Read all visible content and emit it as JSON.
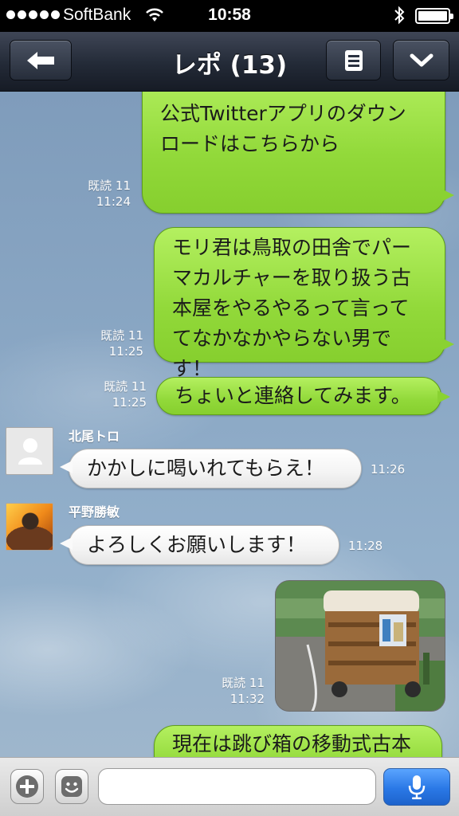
{
  "status_bar": {
    "carrier": "SoftBank",
    "time": "10:58"
  },
  "nav": {
    "title": "レポ (13)",
    "back_icon": "back-arrow-icon",
    "menu_icon": "list-icon",
    "more_icon": "chevron-down-icon"
  },
  "messages": [
    {
      "side": "right",
      "lines": [
        "公式Twitterアプリのダウン",
        "ロードはこちらから"
      ],
      "read": "既読 11",
      "time": "11:24"
    },
    {
      "side": "right",
      "lines": [
        "モリ君は鳥取の田舎でパー",
        "マカルチャーを取り扱う古",
        "本屋をやるやるって言って",
        "てなかなかやらない男で",
        "す！"
      ],
      "read": "既読 11",
      "time": "11:25"
    },
    {
      "side": "right",
      "lines": [
        "ちょいと連絡してみます。"
      ],
      "read": "既読 11",
      "time": "11:25"
    },
    {
      "side": "left",
      "sender": "北尾トロ",
      "text": "かかしに喝いれてもらえ！",
      "time": "11:26"
    },
    {
      "side": "left",
      "sender": "平野勝敏",
      "text": "よろしくお願いします！",
      "time": "11:28"
    },
    {
      "side": "right",
      "type": "photo",
      "read": "既読 11",
      "time": "11:32"
    },
    {
      "side": "right",
      "lines": [
        "現在は跳び箱の移動式古本"
      ]
    }
  ],
  "input_bar": {
    "placeholder": "",
    "plus_icon": "plus-icon",
    "sticker_icon": "emoticon-icon",
    "mic_icon": "microphone-icon"
  },
  "colors": {
    "bubble_green": "#92d93a",
    "bubble_white": "#f4f4f4",
    "nav_bar": "#232a37",
    "mic_button": "#2a78e6"
  }
}
